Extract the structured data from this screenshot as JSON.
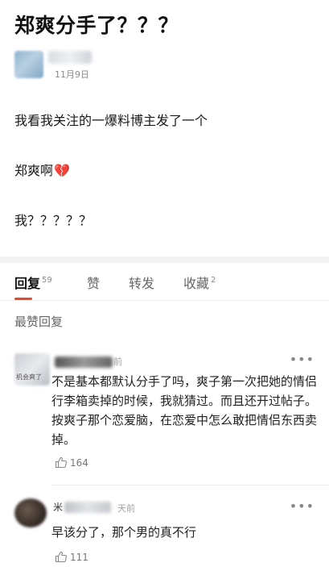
{
  "post": {
    "title": "郑爽分手了？？？",
    "date": "11月9日",
    "lines": [
      "我看我关注的一爆料博主发了一个",
      "郑爽啊",
      "我？？？？？"
    ],
    "heart_icon": "broken-heart-icon"
  },
  "tabs": [
    {
      "label": "回复",
      "count": "59",
      "active": true
    },
    {
      "label": "赞",
      "count": ""
    },
    {
      "label": "转发",
      "count": ""
    },
    {
      "label": "收藏",
      "count": "2"
    }
  ],
  "colors": {
    "accent": "#e34a2e",
    "heart": "#d93a4a"
  },
  "section_label": "最赞回复",
  "comments": [
    {
      "avatar_caption": "机会爽了",
      "time": "前",
      "text": "不是基本都默认分手了吗，爽子第一次把她的情侣行李箱卖掉的时候，我就猜过。而且还开过帖子。按爽子那个恋爱脑，在恋爱中怎么敢把情侣东西卖掉。",
      "likes": "164",
      "more": "•••"
    },
    {
      "name_fragment": "米",
      "time": "天前",
      "text": "早该分了，那个男的真不行",
      "likes": "111",
      "more": "•••"
    }
  ]
}
